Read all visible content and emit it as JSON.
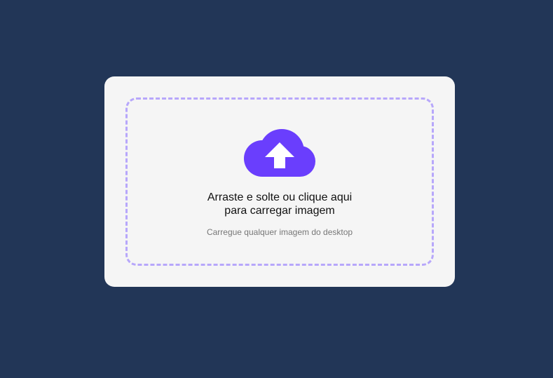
{
  "upload": {
    "title_line1": "Arraste e solte ou clique aqui",
    "title_line2": "para carregar imagem",
    "subtitle": "Carregue qualquer imagem do desktop",
    "icon": "cloud-upload-icon"
  },
  "colors": {
    "background": "#223657",
    "card": "#f5f5f5",
    "dashed_border": "#b7a7fb",
    "icon": "#6a3efd"
  }
}
